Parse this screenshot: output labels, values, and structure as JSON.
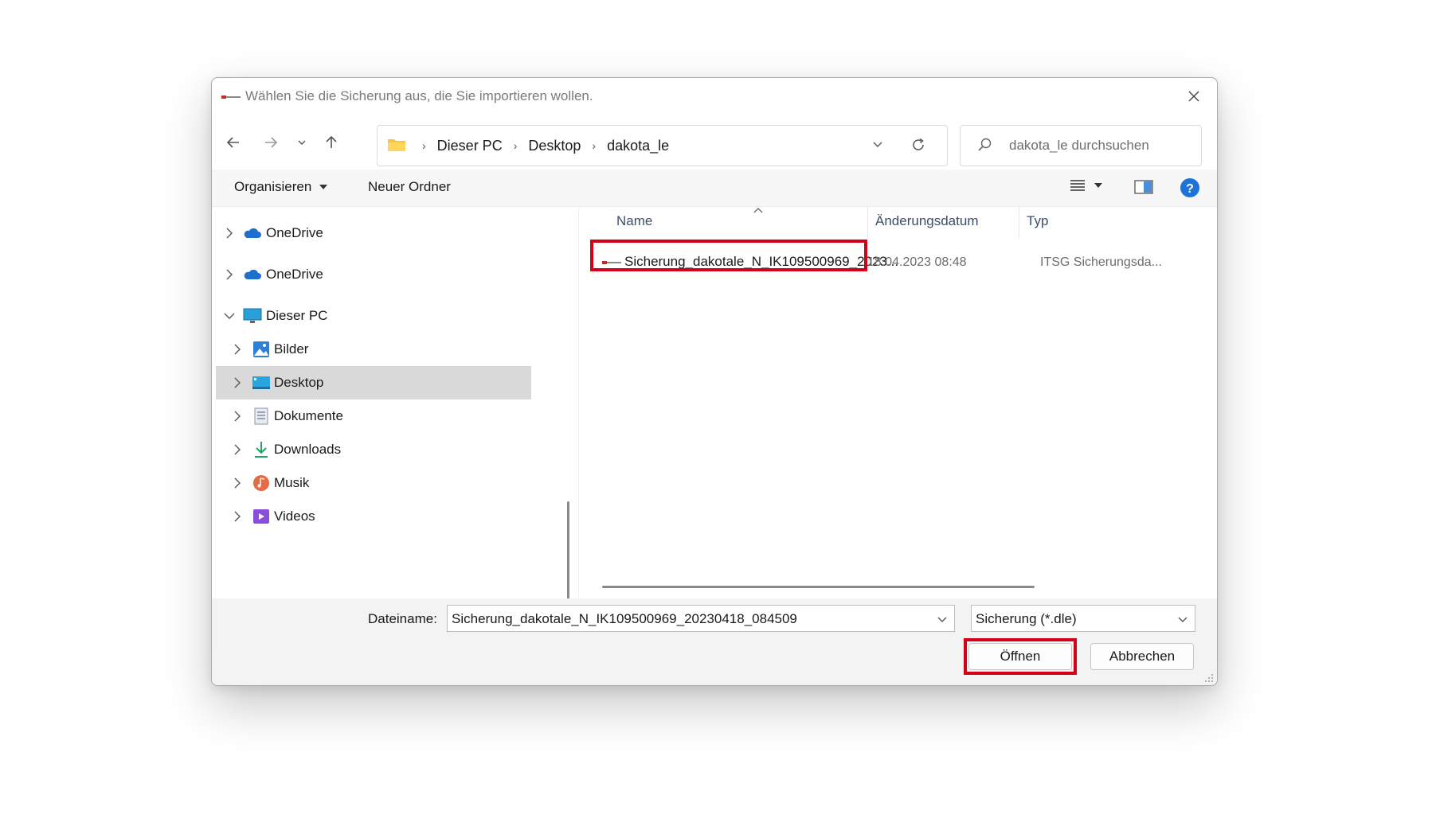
{
  "dialog": {
    "title": "Wählen Sie die Sicherung aus, die Sie importieren wollen."
  },
  "address": {
    "crumbs": [
      "Dieser PC",
      "Desktop",
      "dakota_le"
    ]
  },
  "search": {
    "placeholder": "dakota_le durchsuchen"
  },
  "toolbar": {
    "organize_label": "Organisieren",
    "new_folder_label": "Neuer Ordner"
  },
  "sidebar": {
    "items": [
      {
        "label": "OneDrive",
        "icon": "cloud-icon"
      },
      {
        "label": "OneDrive",
        "icon": "cloud-icon"
      },
      {
        "label": "Dieser PC",
        "icon": "monitor-icon"
      },
      {
        "label": "Bilder",
        "icon": "pictures-icon"
      },
      {
        "label": "Desktop",
        "icon": "desktop-icon"
      },
      {
        "label": "Dokumente",
        "icon": "document-icon"
      },
      {
        "label": "Downloads",
        "icon": "download-icon"
      },
      {
        "label": "Musik",
        "icon": "music-icon"
      },
      {
        "label": "Videos",
        "icon": "video-icon"
      }
    ]
  },
  "filelist": {
    "columns": {
      "name": "Name",
      "date": "Änderungsdatum",
      "type": "Typ"
    },
    "files": [
      {
        "name": "Sicherung_dakotale_N_IK109500969_2023...",
        "date": "18.04.2023 08:48",
        "type": "ITSG Sicherungsda..."
      }
    ]
  },
  "footer": {
    "filename_label": "Dateiname:",
    "filename_value": "Sicherung_dakotale_N_IK109500969_20230418_084509",
    "filter_value": "Sicherung (*.dle)",
    "open_label": "Öffnen",
    "cancel_label": "Abbrechen"
  },
  "colors": {
    "highlight": "#d4001a",
    "selection": "#d9d9d9",
    "onedrive": "#1f6fd1",
    "help": "#1d74d6"
  }
}
